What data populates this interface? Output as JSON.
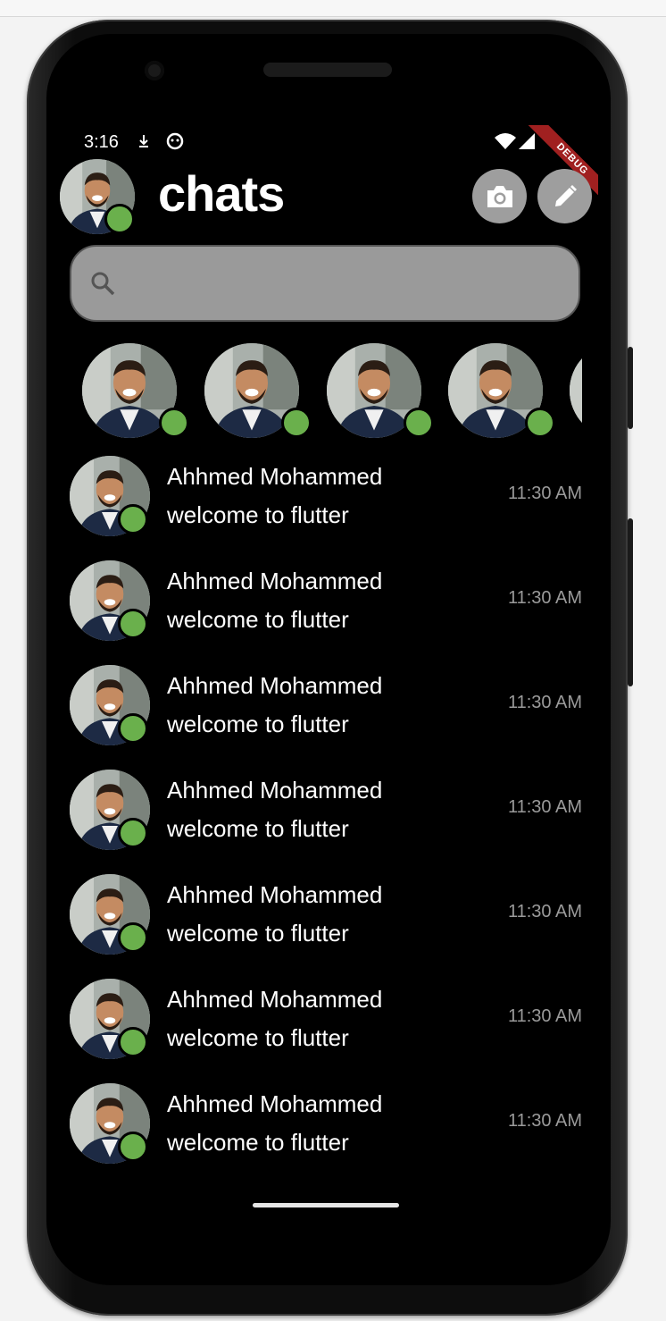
{
  "status_bar": {
    "time": "3:16"
  },
  "debug_banner": "DEBUG",
  "header": {
    "title": "chats"
  },
  "search": {
    "placeholder": ""
  },
  "stories": [
    {
      "online": true
    },
    {
      "online": true
    },
    {
      "online": true
    },
    {
      "online": true
    },
    {
      "online": true
    }
  ],
  "chats": [
    {
      "name": "Ahhmed Mohammed",
      "message": "welcome to flutter",
      "time": "11:30 AM"
    },
    {
      "name": "Ahhmed Mohammed",
      "message": "welcome to flutter",
      "time": "11:30 AM"
    },
    {
      "name": "Ahhmed Mohammed",
      "message": "welcome to flutter",
      "time": "11:30 AM"
    },
    {
      "name": "Ahhmed Mohammed",
      "message": "welcome to flutter",
      "time": "11:30 AM"
    },
    {
      "name": "Ahhmed Mohammed",
      "message": "welcome to flutter",
      "time": "11:30 AM"
    },
    {
      "name": "Ahhmed Mohammed",
      "message": "welcome to flutter",
      "time": "11:30 AM"
    },
    {
      "name": "Ahhmed Mohammed",
      "message": "welcome to flutter",
      "time": "11:30 AM"
    }
  ],
  "colors": {
    "online": "#6ab04c",
    "background": "#000000",
    "button": "#9e9e9e",
    "search_bg": "#9a9a9a",
    "time_text": "#9a9a9a"
  },
  "icons": [
    "camera-icon",
    "edit-icon",
    "search-icon",
    "wifi-icon",
    "signal-icon"
  ]
}
